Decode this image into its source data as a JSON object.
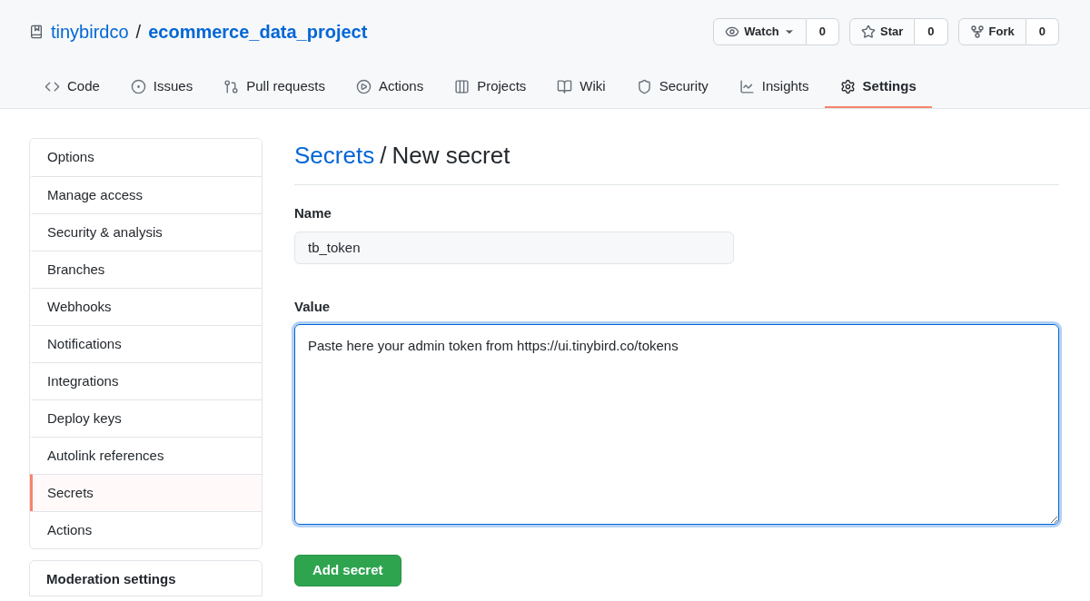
{
  "repo": {
    "owner": "tinybirdco",
    "separator": "/",
    "name": "ecommerce_data_project"
  },
  "actions": [
    {
      "label": "Watch",
      "count": "0",
      "dropdown": true
    },
    {
      "label": "Star",
      "count": "0",
      "dropdown": false
    },
    {
      "label": "Fork",
      "count": "0",
      "dropdown": false
    }
  ],
  "tabs": [
    {
      "label": "Code",
      "selected": false
    },
    {
      "label": "Issues",
      "selected": false
    },
    {
      "label": "Pull requests",
      "selected": false
    },
    {
      "label": "Actions",
      "selected": false
    },
    {
      "label": "Projects",
      "selected": false
    },
    {
      "label": "Wiki",
      "selected": false
    },
    {
      "label": "Security",
      "selected": false
    },
    {
      "label": "Insights",
      "selected": false
    },
    {
      "label": "Settings",
      "selected": true
    }
  ],
  "sidebar": {
    "items": [
      {
        "label": "Options",
        "selected": false
      },
      {
        "label": "Manage access",
        "selected": false
      },
      {
        "label": "Security & analysis",
        "selected": false
      },
      {
        "label": "Branches",
        "selected": false
      },
      {
        "label": "Webhooks",
        "selected": false
      },
      {
        "label": "Notifications",
        "selected": false
      },
      {
        "label": "Integrations",
        "selected": false
      },
      {
        "label": "Deploy keys",
        "selected": false
      },
      {
        "label": "Autolink references",
        "selected": false
      },
      {
        "label": "Secrets",
        "selected": true
      },
      {
        "label": "Actions",
        "selected": false
      }
    ],
    "next_section": "Moderation settings"
  },
  "form": {
    "breadcrumb_link": "Secrets",
    "breadcrumb_separator": "/",
    "title": "New secret",
    "name_label": "Name",
    "name_value": "tb_token",
    "value_label": "Value",
    "value_text": "Paste here your admin token from https://ui.tinybird.co/tokens",
    "submit": "Add secret"
  }
}
